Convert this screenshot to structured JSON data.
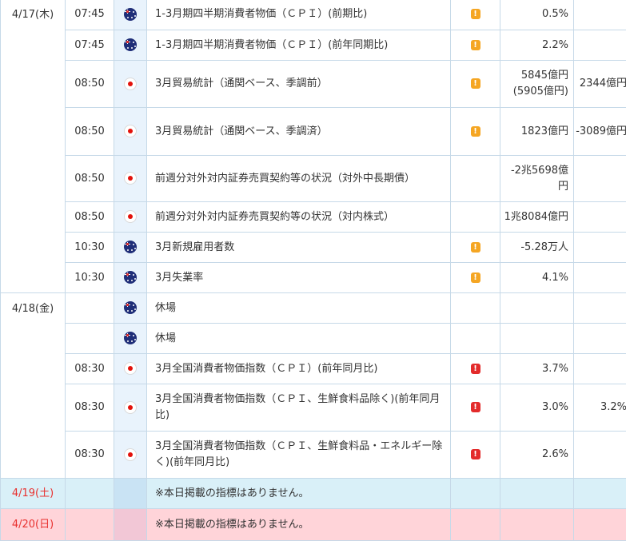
{
  "colors": {
    "border": "#c6d9e8",
    "flag_column": "#e9f3fc",
    "saturday_row": "#d9f0f8",
    "sunday_row": "#ffd4d9",
    "weekend_date_text": "#e8312f",
    "importance_medium": "#f5a623",
    "importance_high": "#e32b2b"
  },
  "days": [
    {
      "date": "4/17(木)"
    },
    {
      "date": "4/18(金)"
    },
    {
      "date": "4/19(土)",
      "note": "※本日掲載の指標はありません。"
    },
    {
      "date": "4/20(日)",
      "note": "※本日掲載の指標はありません。"
    }
  ],
  "rows": [
    {
      "time": "07:45",
      "flag": "australia-flag-icon",
      "name": "1-3月期四半期消費者物価（ＣＰＩ）(前期比)",
      "importance": "warning-icon",
      "previous": "0.5%",
      "forecast": ""
    },
    {
      "time": "07:45",
      "flag": "australia-flag-icon",
      "name": "1-3月期四半期消費者物価（ＣＰＩ）(前年同期比)",
      "importance": "warning-icon",
      "previous": "2.2%",
      "forecast": ""
    },
    {
      "time": "08:50",
      "flag": "japan-flag-icon",
      "name": "3月貿易統計（通関ベース、季調前）",
      "importance": "warning-icon",
      "previous": "5845億円",
      "previous_revised": "(5905億円)",
      "forecast": "2344億円"
    },
    {
      "time": "08:50",
      "flag": "japan-flag-icon",
      "name": "3月貿易統計（通関ベース、季調済）",
      "importance": "warning-icon",
      "previous": "1823億円",
      "forecast": "-3089億円"
    },
    {
      "time": "08:50",
      "flag": "japan-flag-icon",
      "name": "前週分対外対内証券売買契約等の状況（対外中長期債）",
      "importance": "",
      "previous": "-2兆5698億円",
      "forecast": ""
    },
    {
      "time": "08:50",
      "flag": "japan-flag-icon",
      "name": "前週分対外対内証券売買契約等の状況（対内株式）",
      "importance": "",
      "previous": "1兆8084億円",
      "forecast": ""
    },
    {
      "time": "10:30",
      "flag": "australia-flag-icon",
      "name": "3月新規雇用者数",
      "importance": "warning-icon",
      "previous": "-5.28万人",
      "forecast": ""
    },
    {
      "time": "10:30",
      "flag": "australia-flag-icon",
      "name": "3月失業率",
      "importance": "warning-icon",
      "previous": "4.1%",
      "forecast": ""
    },
    {
      "time": "",
      "flag": "australia-flag-icon",
      "name": "休場",
      "importance": "",
      "previous": "",
      "forecast": ""
    },
    {
      "time": "",
      "flag": "australia-flag-icon",
      "name": "休場",
      "importance": "",
      "previous": "",
      "forecast": ""
    },
    {
      "time": "08:30",
      "flag": "japan-flag-icon",
      "name": "3月全国消費者物価指数（ＣＰＩ）(前年同月比)",
      "importance": "alert-icon",
      "previous": "3.7%",
      "forecast": ""
    },
    {
      "time": "08:30",
      "flag": "japan-flag-icon",
      "name": "3月全国消費者物価指数（ＣＰＩ、生鮮食料品除く)(前年同月比)",
      "importance": "alert-icon",
      "previous": "3.0%",
      "forecast": "3.2%"
    },
    {
      "time": "08:30",
      "flag": "japan-flag-icon",
      "name": "3月全国消費者物価指数（ＣＰＩ、生鮮食料品・エネルギー除く)(前年同月比)",
      "importance": "alert-icon",
      "previous": "2.6%",
      "forecast": ""
    }
  ]
}
